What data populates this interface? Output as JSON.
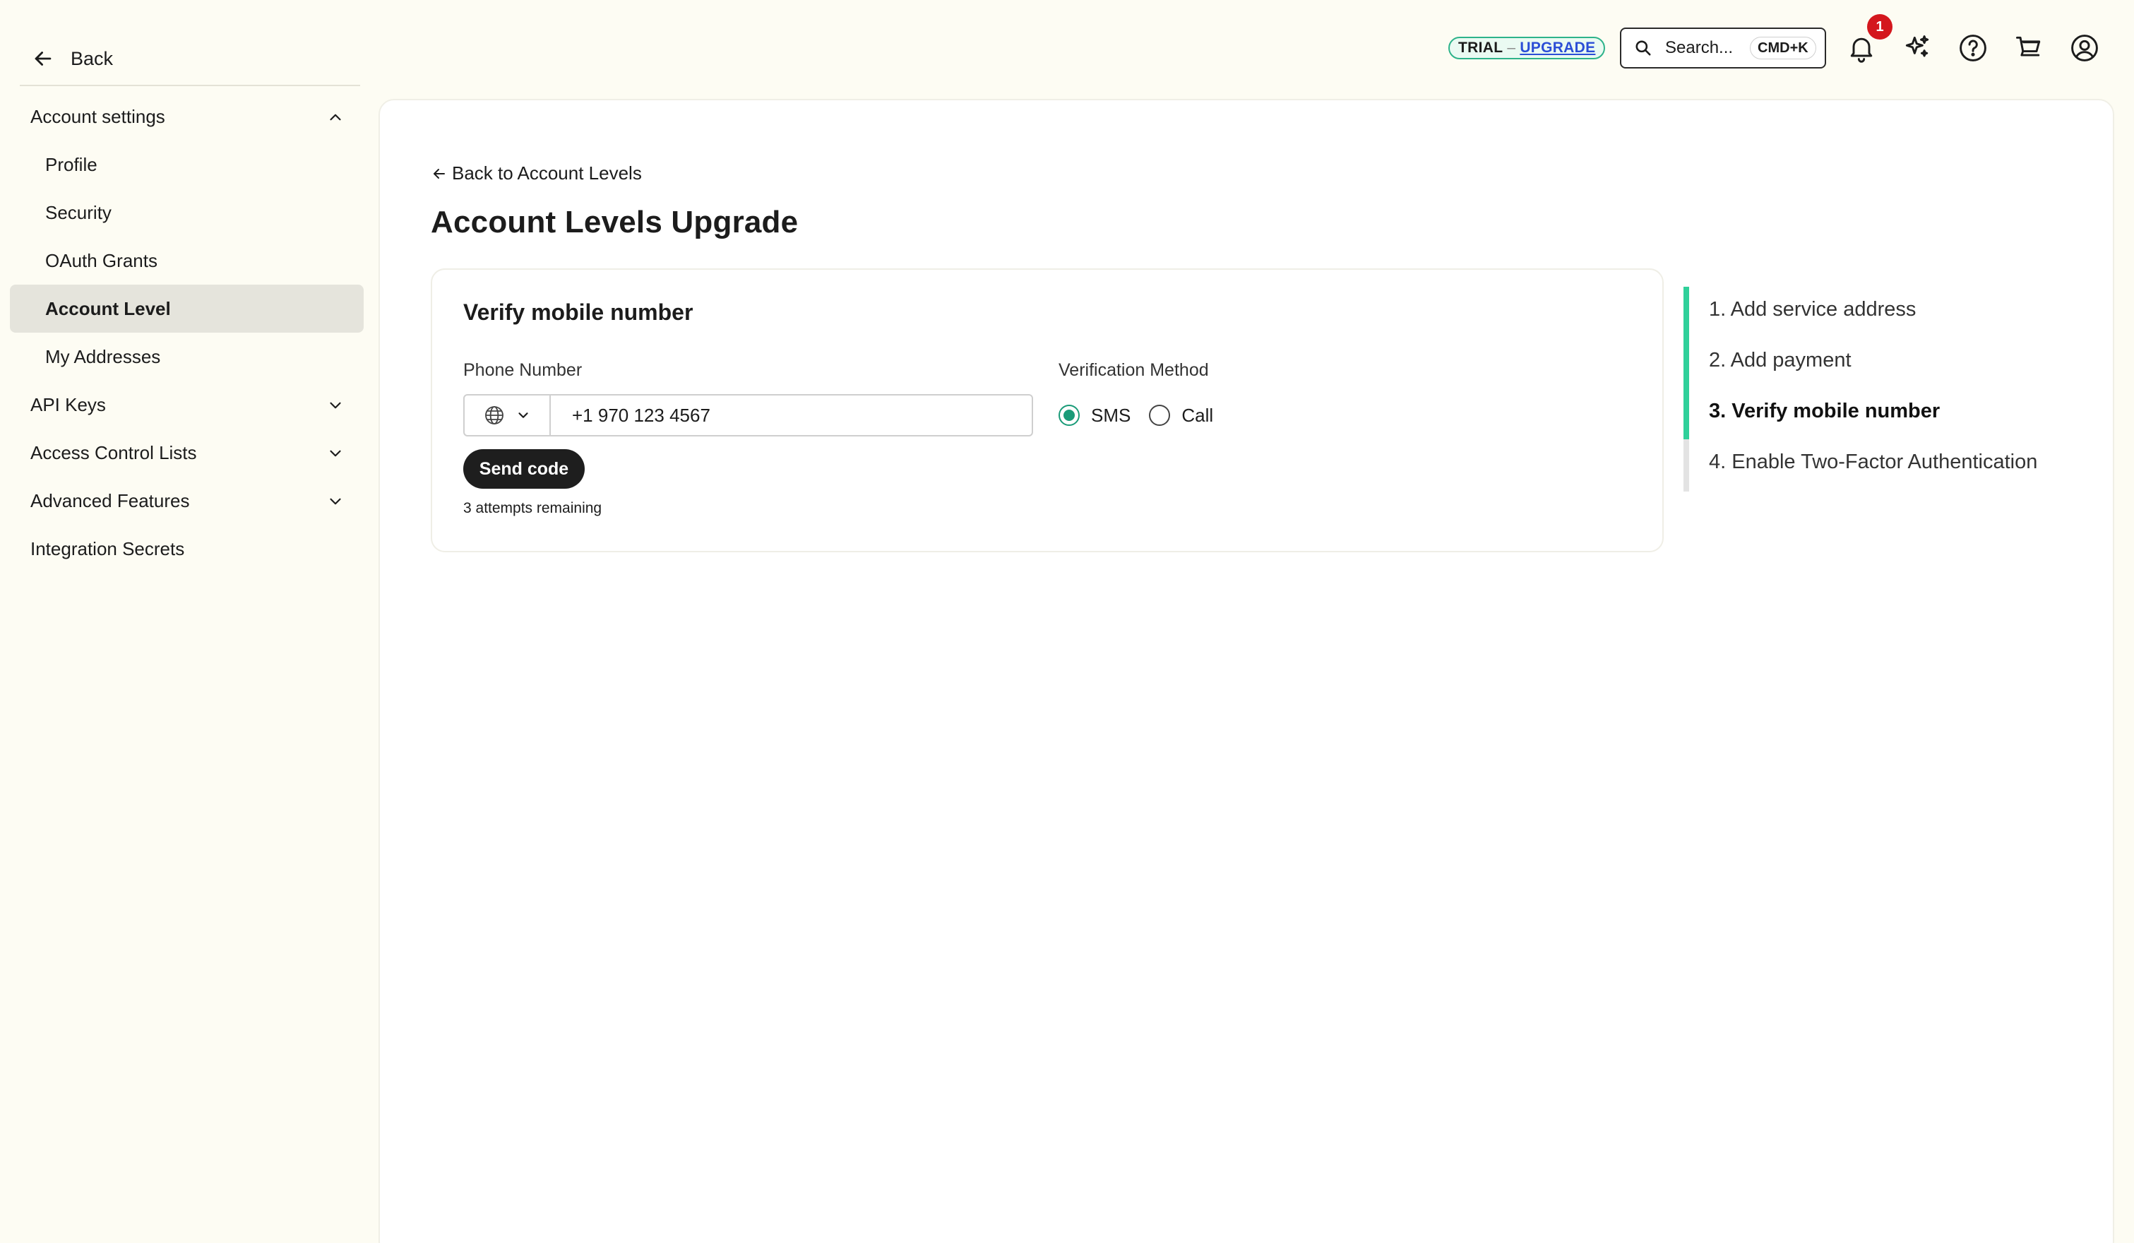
{
  "sidebar": {
    "back_label": "Back",
    "items": [
      {
        "label": "Account settings",
        "level": "top",
        "chevron": "up"
      },
      {
        "label": "Profile",
        "level": "sub"
      },
      {
        "label": "Security",
        "level": "sub"
      },
      {
        "label": "OAuth Grants",
        "level": "sub"
      },
      {
        "label": "Account Level",
        "level": "sub",
        "active": true
      },
      {
        "label": "My Addresses",
        "level": "sub"
      },
      {
        "label": "API Keys",
        "level": "top",
        "chevron": "down"
      },
      {
        "label": "Access Control Lists",
        "level": "top",
        "chevron": "down"
      },
      {
        "label": "Advanced Features",
        "level": "top",
        "chevron": "down"
      },
      {
        "label": "Integration Secrets",
        "level": "top"
      }
    ]
  },
  "topbar": {
    "trial_label": "TRIAL",
    "trial_separator": "–",
    "upgrade_label": "UPGRADE",
    "search_label": "Search...",
    "search_shortcut": "CMD+K",
    "notification_count": "1",
    "icons": [
      "bell-icon",
      "sparkle-icon",
      "help-icon",
      "cart-icon",
      "user-icon"
    ]
  },
  "main": {
    "back_link": "Back to Account Levels",
    "title": "Account Levels Upgrade",
    "card": {
      "title": "Verify mobile number",
      "phone_label": "Phone Number",
      "phone_value": "+1 970 123 4567",
      "method_label": "Verification Method",
      "methods": [
        {
          "label": "SMS",
          "checked": true
        },
        {
          "label": "Call",
          "checked": false
        }
      ],
      "send_button": "Send code",
      "attempts": "3 attempts remaining"
    },
    "steps": [
      {
        "label": "1. Add service address",
        "state": "done"
      },
      {
        "label": "2. Add payment",
        "state": "done"
      },
      {
        "label": "3. Verify mobile number",
        "state": "current"
      },
      {
        "label": "4. Enable Two-Factor Authentication",
        "state": "pending"
      }
    ]
  },
  "colors": {
    "background": "#fdfcf3",
    "accent_green": "#2fd09a",
    "radio_green": "#1a9b78",
    "upgrade_blue": "#2b4ed6",
    "badge_red": "#d4171d"
  }
}
